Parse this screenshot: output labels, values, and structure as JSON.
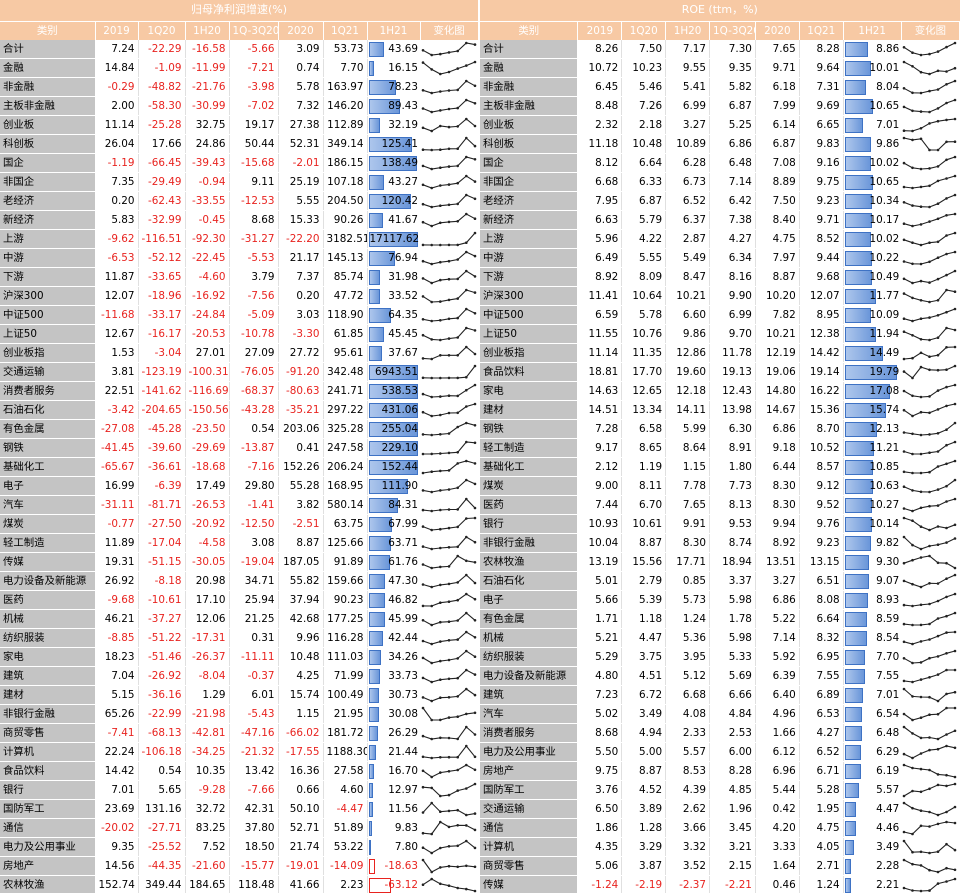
{
  "left": {
    "title": "归母净利润增速(%)",
    "headers": [
      "类别",
      "2019",
      "1Q20",
      "1H20",
      "1Q-3Q20",
      "2020",
      "1Q21",
      "1H21",
      "变化图"
    ],
    "separators_after": [
      0,
      2,
      5,
      7,
      11,
      12
    ],
    "rows": [
      [
        "合计",
        "7.24",
        "-22.29",
        "-16.58",
        "-5.66",
        "3.09",
        "53.73",
        "43.69"
      ],
      [
        "金融",
        "14.84",
        "-1.09",
        "-11.99",
        "-7.21",
        "0.74",
        "7.70",
        "16.15"
      ],
      [
        "非金融",
        "-0.29",
        "-48.82",
        "-21.76",
        "-3.98",
        "5.78",
        "163.97",
        "78.23"
      ],
      [
        "主板非金融",
        "2.00",
        "-58.30",
        "-30.99",
        "-7.02",
        "7.32",
        "146.20",
        "89.43"
      ],
      [
        "创业板",
        "11.14",
        "-25.28",
        "32.75",
        "19.17",
        "27.38",
        "112.89",
        "32.19"
      ],
      [
        "科创板",
        "26.04",
        "17.66",
        "24.86",
        "50.44",
        "52.31",
        "349.14",
        "125.41"
      ],
      [
        "国企",
        "-1.19",
        "-66.45",
        "-39.43",
        "-15.68",
        "-2.01",
        "186.15",
        "138.49"
      ],
      [
        "非国企",
        "7.35",
        "-29.49",
        "-0.94",
        "9.11",
        "25.19",
        "107.18",
        "43.27"
      ],
      [
        "老经济",
        "0.20",
        "-62.43",
        "-33.55",
        "-12.53",
        "5.55",
        "204.50",
        "120.42"
      ],
      [
        "新经济",
        "5.83",
        "-32.99",
        "-0.45",
        "8.68",
        "15.33",
        "90.26",
        "41.67"
      ],
      [
        "上游",
        "-9.62",
        "-116.51",
        "-92.30",
        "-31.27",
        "-22.20",
        "3182.51",
        "17117.62"
      ],
      [
        "中游",
        "-6.53",
        "-52.12",
        "-22.45",
        "-5.53",
        "21.17",
        "145.13",
        "76.94"
      ],
      [
        "下游",
        "11.87",
        "-33.65",
        "-4.60",
        "3.79",
        "7.37",
        "85.74",
        "31.98"
      ],
      [
        "沪深300",
        "12.07",
        "-18.96",
        "-16.92",
        "-7.56",
        "0.20",
        "47.72",
        "33.52"
      ],
      [
        "中证500",
        "-11.68",
        "-33.17",
        "-24.84",
        "-5.09",
        "3.03",
        "118.90",
        "64.35"
      ],
      [
        "上证50",
        "12.67",
        "-16.17",
        "-20.53",
        "-10.78",
        "-3.30",
        "61.85",
        "45.45"
      ],
      [
        "创业板指",
        "1.53",
        "-3.04",
        "27.01",
        "27.09",
        "27.72",
        "95.61",
        "37.67"
      ],
      [
        "交通运输",
        "3.81",
        "-123.19",
        "-100.31",
        "-76.05",
        "-91.20",
        "342.48",
        "6943.51"
      ],
      [
        "消费者服务",
        "22.51",
        "-141.62",
        "-116.69",
        "-68.37",
        "-80.63",
        "241.71",
        "538.53"
      ],
      [
        "石油石化",
        "-3.42",
        "-204.65",
        "-150.56",
        "-43.28",
        "-35.21",
        "297.22",
        "431.06"
      ],
      [
        "有色金属",
        "-27.08",
        "-45.28",
        "-23.50",
        "0.54",
        "203.06",
        "325.28",
        "255.04"
      ],
      [
        "钢铁",
        "-41.45",
        "-39.60",
        "-29.69",
        "-13.87",
        "0.41",
        "247.58",
        "229.10"
      ],
      [
        "基础化工",
        "-65.67",
        "-36.61",
        "-18.68",
        "-7.16",
        "152.26",
        "206.24",
        "152.44"
      ],
      [
        "电子",
        "16.99",
        "-6.39",
        "17.49",
        "29.80",
        "55.28",
        "168.95",
        "111.90"
      ],
      [
        "汽车",
        "-31.11",
        "-81.71",
        "-26.53",
        "-1.41",
        "3.82",
        "580.14",
        "84.31"
      ],
      [
        "煤炭",
        "-0.77",
        "-27.50",
        "-20.92",
        "-12.50",
        "-2.51",
        "63.75",
        "67.99"
      ],
      [
        "轻工制造",
        "11.89",
        "-17.04",
        "-4.58",
        "3.08",
        "8.87",
        "125.66",
        "63.71"
      ],
      [
        "传媒",
        "19.31",
        "-51.15",
        "-30.05",
        "-19.04",
        "187.05",
        "91.89",
        "61.76"
      ],
      [
        "电力设备及新能源",
        "26.92",
        "-8.18",
        "20.98",
        "34.71",
        "55.82",
        "159.66",
        "47.30"
      ],
      [
        "医药",
        "-9.68",
        "-10.61",
        "17.10",
        "25.94",
        "37.94",
        "90.23",
        "46.82"
      ],
      [
        "机械",
        "46.21",
        "-37.27",
        "12.06",
        "21.25",
        "42.68",
        "177.25",
        "45.99"
      ],
      [
        "纺织服装",
        "-8.85",
        "-51.22",
        "-17.31",
        "0.31",
        "9.96",
        "116.28",
        "42.44"
      ],
      [
        "家电",
        "18.23",
        "-51.46",
        "-26.37",
        "-11.11",
        "10.48",
        "111.03",
        "34.26"
      ],
      [
        "建筑",
        "7.04",
        "-26.92",
        "-8.04",
        "-0.37",
        "4.25",
        "71.99",
        "33.73"
      ],
      [
        "建材",
        "5.15",
        "-36.16",
        "1.29",
        "6.01",
        "15.74",
        "100.49",
        "30.73"
      ],
      [
        "非银行金融",
        "65.26",
        "-22.99",
        "-21.98",
        "-5.43",
        "1.15",
        "21.95",
        "30.08"
      ],
      [
        "商贸零售",
        "-7.41",
        "-68.13",
        "-42.81",
        "-47.16",
        "-66.02",
        "181.72",
        "26.29"
      ],
      [
        "计算机",
        "22.24",
        "-106.18",
        "-34.25",
        "-21.32",
        "-17.55",
        "1188.30",
        "21.44"
      ],
      [
        "食品饮料",
        "14.42",
        "0.54",
        "10.35",
        "13.42",
        "16.36",
        "27.58",
        "16.70"
      ],
      [
        "银行",
        "7.01",
        "5.65",
        "-9.28",
        "-7.66",
        "0.66",
        "4.60",
        "12.97"
      ],
      [
        "国防军工",
        "23.69",
        "131.16",
        "32.72",
        "42.31",
        "50.10",
        "-4.47",
        "11.56"
      ],
      [
        "通信",
        "-20.02",
        "-27.71",
        "83.25",
        "37.80",
        "52.71",
        "51.89",
        "9.83"
      ],
      [
        "电力及公用事业",
        "9.35",
        "-25.52",
        "7.52",
        "18.50",
        "21.74",
        "53.22",
        "7.80"
      ],
      [
        "房地产",
        "14.56",
        "-44.35",
        "-21.60",
        "-15.77",
        "-19.01",
        "-14.09",
        "-18.63"
      ],
      [
        "农林牧渔",
        "152.74",
        "349.44",
        "184.65",
        "118.48",
        "41.66",
        "2.23",
        "-63.12"
      ]
    ]
  },
  "right": {
    "title": "ROE (ttm，%)",
    "headers": [
      "类别",
      "2019",
      "1Q20",
      "1H20",
      "1Q-3Q20",
      "2020",
      "1Q21",
      "1H21",
      "变化图"
    ],
    "separators_after": [
      0,
      2,
      5,
      7,
      11,
      12,
      16
    ],
    "rows": [
      [
        "合计",
        "8.26",
        "7.50",
        "7.17",
        "7.30",
        "7.65",
        "8.28",
        "8.86"
      ],
      [
        "金融",
        "10.72",
        "10.23",
        "9.55",
        "9.35",
        "9.71",
        "9.64",
        "10.01"
      ],
      [
        "非金融",
        "6.45",
        "5.46",
        "5.41",
        "5.82",
        "6.18",
        "7.31",
        "8.04"
      ],
      [
        "主板非金融",
        "8.48",
        "7.26",
        "6.99",
        "6.87",
        "7.99",
        "9.69",
        "10.65"
      ],
      [
        "创业板",
        "2.32",
        "2.18",
        "3.27",
        "5.25",
        "6.14",
        "6.65",
        "7.01"
      ],
      [
        "科创板",
        "11.18",
        "10.48",
        "10.89",
        "6.86",
        "6.87",
        "9.83",
        "9.86"
      ],
      [
        "国企",
        "8.12",
        "6.64",
        "6.28",
        "6.48",
        "7.08",
        "9.16",
        "10.02"
      ],
      [
        "非国企",
        "6.68",
        "6.33",
        "6.73",
        "7.14",
        "8.89",
        "9.75",
        "10.65"
      ],
      [
        "老经济",
        "7.95",
        "6.87",
        "6.52",
        "6.42",
        "7.50",
        "9.23",
        "10.34"
      ],
      [
        "新经济",
        "6.63",
        "5.79",
        "6.37",
        "7.38",
        "8.40",
        "9.71",
        "10.17"
      ],
      [
        "上游",
        "5.96",
        "4.22",
        "2.87",
        "4.27",
        "4.75",
        "8.52",
        "10.02"
      ],
      [
        "中游",
        "6.49",
        "5.55",
        "5.49",
        "6.34",
        "7.97",
        "9.44",
        "10.22"
      ],
      [
        "下游",
        "8.92",
        "8.09",
        "8.47",
        "8.16",
        "8.87",
        "9.68",
        "10.49"
      ],
      [
        "沪深300",
        "11.41",
        "10.64",
        "10.21",
        "9.90",
        "10.20",
        "12.07",
        "11.77"
      ],
      [
        "中证500",
        "6.59",
        "5.78",
        "6.60",
        "6.99",
        "7.82",
        "8.95",
        "10.09"
      ],
      [
        "上证50",
        "11.55",
        "10.76",
        "9.86",
        "9.70",
        "10.21",
        "12.38",
        "11.94"
      ],
      [
        "创业板指",
        "11.14",
        "11.35",
        "12.86",
        "11.78",
        "12.19",
        "14.42",
        "14.49"
      ],
      [
        "食品饮料",
        "18.81",
        "17.70",
        "19.60",
        "19.13",
        "19.06",
        "19.14",
        "19.79"
      ],
      [
        "家电",
        "14.63",
        "12.65",
        "12.18",
        "12.43",
        "14.80",
        "16.22",
        "17.08"
      ],
      [
        "建材",
        "14.51",
        "13.34",
        "14.11",
        "13.98",
        "14.67",
        "15.36",
        "15.74"
      ],
      [
        "钢铁",
        "7.28",
        "6.58",
        "5.99",
        "6.30",
        "6.86",
        "8.70",
        "12.13"
      ],
      [
        "轻工制造",
        "9.17",
        "8.65",
        "8.64",
        "8.91",
        "9.18",
        "10.52",
        "11.21"
      ],
      [
        "基础化工",
        "2.12",
        "1.19",
        "1.15",
        "1.80",
        "6.44",
        "8.57",
        "10.85"
      ],
      [
        "煤炭",
        "9.00",
        "8.11",
        "7.78",
        "7.73",
        "8.30",
        "9.12",
        "10.63"
      ],
      [
        "医药",
        "7.44",
        "6.70",
        "7.65",
        "8.13",
        "8.30",
        "9.52",
        "10.27"
      ],
      [
        "银行",
        "10.93",
        "10.61",
        "9.91",
        "9.53",
        "9.94",
        "9.76",
        "10.14"
      ],
      [
        "非银行金融",
        "10.04",
        "8.87",
        "8.30",
        "8.74",
        "8.92",
        "9.23",
        "9.82"
      ],
      [
        "农林牧渔",
        "13.19",
        "15.56",
        "17.71",
        "18.94",
        "13.51",
        "13.15",
        "9.30"
      ],
      [
        "石油石化",
        "5.01",
        "2.79",
        "0.85",
        "3.37",
        "3.27",
        "6.51",
        "9.07"
      ],
      [
        "电子",
        "5.66",
        "5.39",
        "5.73",
        "5.98",
        "6.86",
        "8.08",
        "8.93"
      ],
      [
        "有色金属",
        "1.71",
        "1.18",
        "1.24",
        "1.78",
        "5.22",
        "6.64",
        "8.59"
      ],
      [
        "机械",
        "5.21",
        "4.47",
        "5.36",
        "5.98",
        "7.14",
        "8.32",
        "8.54"
      ],
      [
        "纺织服装",
        "5.29",
        "3.75",
        "3.95",
        "5.33",
        "5.92",
        "6.95",
        "7.70"
      ],
      [
        "电力设备及新能源",
        "4.80",
        "4.51",
        "5.12",
        "5.69",
        "6.39",
        "7.55",
        "7.55"
      ],
      [
        "建筑",
        "7.23",
        "6.72",
        "6.68",
        "6.66",
        "6.40",
        "6.89",
        "7.01"
      ],
      [
        "汽车",
        "5.02",
        "3.49",
        "4.08",
        "4.84",
        "4.96",
        "6.53",
        "6.54"
      ],
      [
        "消费者服务",
        "8.68",
        "4.94",
        "2.33",
        "2.53",
        "1.66",
        "4.27",
        "6.48"
      ],
      [
        "电力及公用事业",
        "5.50",
        "5.00",
        "5.57",
        "6.00",
        "6.12",
        "6.52",
        "6.29"
      ],
      [
        "房地产",
        "9.75",
        "8.87",
        "8.53",
        "8.28",
        "6.96",
        "6.71",
        "6.19"
      ],
      [
        "国防军工",
        "3.76",
        "4.52",
        "4.39",
        "4.85",
        "5.44",
        "5.28",
        "5.57"
      ],
      [
        "交通运输",
        "6.50",
        "3.89",
        "2.62",
        "1.96",
        "0.42",
        "1.95",
        "4.47"
      ],
      [
        "通信",
        "1.86",
        "1.28",
        "3.66",
        "3.45",
        "4.20",
        "4.75",
        "4.46"
      ],
      [
        "计算机",
        "4.35",
        "3.29",
        "3.32",
        "3.21",
        "3.33",
        "4.05",
        "3.49"
      ],
      [
        "商贸零售",
        "5.06",
        "3.87",
        "3.52",
        "2.15",
        "1.64",
        "2.71",
        "2.28"
      ],
      [
        "传媒",
        "-1.24",
        "-2.19",
        "-2.37",
        "-2.21",
        "0.46",
        "1.24",
        "2.21"
      ]
    ]
  }
}
